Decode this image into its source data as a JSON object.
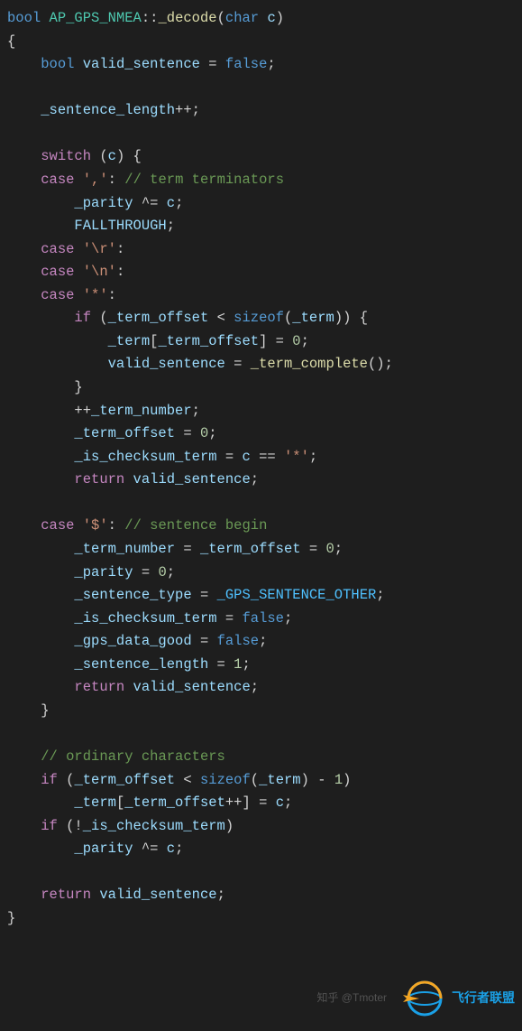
{
  "code": {
    "lines": [
      {
        "indent": 0,
        "tokens": [
          {
            "cls": "kw",
            "t": "bool"
          },
          {
            "cls": "op",
            "t": " "
          },
          {
            "cls": "cls",
            "t": "AP_GPS_NMEA"
          },
          {
            "cls": "op",
            "t": "::"
          },
          {
            "cls": "fn",
            "t": "_decode"
          },
          {
            "cls": "op",
            "t": "("
          },
          {
            "cls": "kw",
            "t": "char"
          },
          {
            "cls": "op",
            "t": " "
          },
          {
            "cls": "var",
            "t": "c"
          },
          {
            "cls": "op",
            "t": ")"
          }
        ]
      },
      {
        "indent": 0,
        "tokens": [
          {
            "cls": "op",
            "t": "{"
          }
        ]
      },
      {
        "indent": 1,
        "tokens": [
          {
            "cls": "kw",
            "t": "bool"
          },
          {
            "cls": "op",
            "t": " "
          },
          {
            "cls": "var",
            "t": "valid_sentence"
          },
          {
            "cls": "op",
            "t": " = "
          },
          {
            "cls": "kw",
            "t": "false"
          },
          {
            "cls": "op",
            "t": ";"
          }
        ]
      },
      {
        "indent": 0,
        "tokens": []
      },
      {
        "indent": 1,
        "tokens": [
          {
            "cls": "var",
            "t": "_sentence_length"
          },
          {
            "cls": "op",
            "t": "++;"
          }
        ]
      },
      {
        "indent": 0,
        "tokens": []
      },
      {
        "indent": 1,
        "tokens": [
          {
            "cls": "macro",
            "t": "switch"
          },
          {
            "cls": "op",
            "t": " ("
          },
          {
            "cls": "var",
            "t": "c"
          },
          {
            "cls": "op",
            "t": ") {"
          }
        ]
      },
      {
        "indent": 1,
        "tokens": [
          {
            "cls": "macro",
            "t": "case"
          },
          {
            "cls": "op",
            "t": " "
          },
          {
            "cls": "str",
            "t": "','"
          },
          {
            "cls": "op",
            "t": ": "
          },
          {
            "cls": "cmt",
            "t": "// term terminators"
          }
        ]
      },
      {
        "indent": 2,
        "tokens": [
          {
            "cls": "var",
            "t": "_parity"
          },
          {
            "cls": "op",
            "t": " ^= "
          },
          {
            "cls": "var",
            "t": "c"
          },
          {
            "cls": "op",
            "t": ";"
          }
        ]
      },
      {
        "indent": 2,
        "tokens": [
          {
            "cls": "var",
            "t": "FALLTHROUGH"
          },
          {
            "cls": "op",
            "t": ";"
          }
        ]
      },
      {
        "indent": 1,
        "tokens": [
          {
            "cls": "macro",
            "t": "case"
          },
          {
            "cls": "op",
            "t": " "
          },
          {
            "cls": "str",
            "t": "'\\r'"
          },
          {
            "cls": "op",
            "t": ":"
          }
        ]
      },
      {
        "indent": 1,
        "tokens": [
          {
            "cls": "macro",
            "t": "case"
          },
          {
            "cls": "op",
            "t": " "
          },
          {
            "cls": "str",
            "t": "'\\n'"
          },
          {
            "cls": "op",
            "t": ":"
          }
        ]
      },
      {
        "indent": 1,
        "tokens": [
          {
            "cls": "macro",
            "t": "case"
          },
          {
            "cls": "op",
            "t": " "
          },
          {
            "cls": "str",
            "t": "'*'"
          },
          {
            "cls": "op",
            "t": ":"
          }
        ]
      },
      {
        "indent": 2,
        "tokens": [
          {
            "cls": "macro",
            "t": "if"
          },
          {
            "cls": "op",
            "t": " ("
          },
          {
            "cls": "var",
            "t": "_term_offset"
          },
          {
            "cls": "op",
            "t": " < "
          },
          {
            "cls": "kw",
            "t": "sizeof"
          },
          {
            "cls": "op",
            "t": "("
          },
          {
            "cls": "var",
            "t": "_term"
          },
          {
            "cls": "op",
            "t": ")) {"
          }
        ]
      },
      {
        "indent": 3,
        "tokens": [
          {
            "cls": "var",
            "t": "_term"
          },
          {
            "cls": "op",
            "t": "["
          },
          {
            "cls": "var",
            "t": "_term_offset"
          },
          {
            "cls": "op",
            "t": "] = "
          },
          {
            "cls": "num",
            "t": "0"
          },
          {
            "cls": "op",
            "t": ";"
          }
        ]
      },
      {
        "indent": 3,
        "tokens": [
          {
            "cls": "var",
            "t": "valid_sentence"
          },
          {
            "cls": "op",
            "t": " = "
          },
          {
            "cls": "fn",
            "t": "_term_complete"
          },
          {
            "cls": "op",
            "t": "();"
          }
        ]
      },
      {
        "indent": 2,
        "tokens": [
          {
            "cls": "op",
            "t": "}"
          }
        ]
      },
      {
        "indent": 2,
        "tokens": [
          {
            "cls": "op",
            "t": "++"
          },
          {
            "cls": "var",
            "t": "_term_number"
          },
          {
            "cls": "op",
            "t": ";"
          }
        ]
      },
      {
        "indent": 2,
        "tokens": [
          {
            "cls": "var",
            "t": "_term_offset"
          },
          {
            "cls": "op",
            "t": " = "
          },
          {
            "cls": "num",
            "t": "0"
          },
          {
            "cls": "op",
            "t": ";"
          }
        ]
      },
      {
        "indent": 2,
        "tokens": [
          {
            "cls": "var",
            "t": "_is_checksum_term"
          },
          {
            "cls": "op",
            "t": " = "
          },
          {
            "cls": "var",
            "t": "c"
          },
          {
            "cls": "op",
            "t": " == "
          },
          {
            "cls": "str",
            "t": "'*'"
          },
          {
            "cls": "op",
            "t": ";"
          }
        ]
      },
      {
        "indent": 2,
        "tokens": [
          {
            "cls": "macro",
            "t": "return"
          },
          {
            "cls": "op",
            "t": " "
          },
          {
            "cls": "var",
            "t": "valid_sentence"
          },
          {
            "cls": "op",
            "t": ";"
          }
        ]
      },
      {
        "indent": 0,
        "tokens": []
      },
      {
        "indent": 1,
        "tokens": [
          {
            "cls": "macro",
            "t": "case"
          },
          {
            "cls": "op",
            "t": " "
          },
          {
            "cls": "str",
            "t": "'$'"
          },
          {
            "cls": "op",
            "t": ": "
          },
          {
            "cls": "cmt",
            "t": "// sentence begin"
          }
        ]
      },
      {
        "indent": 2,
        "tokens": [
          {
            "cls": "var",
            "t": "_term_number"
          },
          {
            "cls": "op",
            "t": " = "
          },
          {
            "cls": "var",
            "t": "_term_offset"
          },
          {
            "cls": "op",
            "t": " = "
          },
          {
            "cls": "num",
            "t": "0"
          },
          {
            "cls": "op",
            "t": ";"
          }
        ]
      },
      {
        "indent": 2,
        "tokens": [
          {
            "cls": "var",
            "t": "_parity"
          },
          {
            "cls": "op",
            "t": " = "
          },
          {
            "cls": "num",
            "t": "0"
          },
          {
            "cls": "op",
            "t": ";"
          }
        ]
      },
      {
        "indent": 2,
        "tokens": [
          {
            "cls": "var",
            "t": "_sentence_type"
          },
          {
            "cls": "op",
            "t": " = "
          },
          {
            "cls": "const",
            "t": "_GPS_SENTENCE_OTHER"
          },
          {
            "cls": "op",
            "t": ";"
          }
        ]
      },
      {
        "indent": 2,
        "tokens": [
          {
            "cls": "var",
            "t": "_is_checksum_term"
          },
          {
            "cls": "op",
            "t": " = "
          },
          {
            "cls": "kw",
            "t": "false"
          },
          {
            "cls": "op",
            "t": ";"
          }
        ]
      },
      {
        "indent": 2,
        "tokens": [
          {
            "cls": "var",
            "t": "_gps_data_good"
          },
          {
            "cls": "op",
            "t": " = "
          },
          {
            "cls": "kw",
            "t": "false"
          },
          {
            "cls": "op",
            "t": ";"
          }
        ]
      },
      {
        "indent": 2,
        "tokens": [
          {
            "cls": "var",
            "t": "_sentence_length"
          },
          {
            "cls": "op",
            "t": " = "
          },
          {
            "cls": "num",
            "t": "1"
          },
          {
            "cls": "op",
            "t": ";"
          }
        ]
      },
      {
        "indent": 2,
        "tokens": [
          {
            "cls": "macro",
            "t": "return"
          },
          {
            "cls": "op",
            "t": " "
          },
          {
            "cls": "var",
            "t": "valid_sentence"
          },
          {
            "cls": "op",
            "t": ";"
          }
        ]
      },
      {
        "indent": 1,
        "tokens": [
          {
            "cls": "op",
            "t": "}"
          }
        ]
      },
      {
        "indent": 0,
        "tokens": []
      },
      {
        "indent": 1,
        "tokens": [
          {
            "cls": "cmt",
            "t": "// ordinary characters"
          }
        ]
      },
      {
        "indent": 1,
        "tokens": [
          {
            "cls": "macro",
            "t": "if"
          },
          {
            "cls": "op",
            "t": " ("
          },
          {
            "cls": "var",
            "t": "_term_offset"
          },
          {
            "cls": "op",
            "t": " < "
          },
          {
            "cls": "kw",
            "t": "sizeof"
          },
          {
            "cls": "op",
            "t": "("
          },
          {
            "cls": "var",
            "t": "_term"
          },
          {
            "cls": "op",
            "t": ") - "
          },
          {
            "cls": "num",
            "t": "1"
          },
          {
            "cls": "op",
            "t": ")"
          }
        ]
      },
      {
        "indent": 2,
        "tokens": [
          {
            "cls": "var",
            "t": "_term"
          },
          {
            "cls": "op",
            "t": "["
          },
          {
            "cls": "var",
            "t": "_term_offset"
          },
          {
            "cls": "op",
            "t": "++] = "
          },
          {
            "cls": "var",
            "t": "c"
          },
          {
            "cls": "op",
            "t": ";"
          }
        ]
      },
      {
        "indent": 1,
        "tokens": [
          {
            "cls": "macro",
            "t": "if"
          },
          {
            "cls": "op",
            "t": " (!"
          },
          {
            "cls": "var",
            "t": "_is_checksum_term"
          },
          {
            "cls": "op",
            "t": ")"
          }
        ]
      },
      {
        "indent": 2,
        "tokens": [
          {
            "cls": "var",
            "t": "_parity"
          },
          {
            "cls": "op",
            "t": " ^= "
          },
          {
            "cls": "var",
            "t": "c"
          },
          {
            "cls": "op",
            "t": ";"
          }
        ]
      },
      {
        "indent": 0,
        "tokens": []
      },
      {
        "indent": 1,
        "tokens": [
          {
            "cls": "macro",
            "t": "return"
          },
          {
            "cls": "op",
            "t": " "
          },
          {
            "cls": "var",
            "t": "valid_sentence"
          },
          {
            "cls": "op",
            "t": ";"
          }
        ]
      },
      {
        "indent": 0,
        "tokens": [
          {
            "cls": "op",
            "t": "}"
          }
        ]
      }
    ]
  },
  "watermark": "知乎 @Tmoter",
  "logo_text": "飞行者联盟"
}
